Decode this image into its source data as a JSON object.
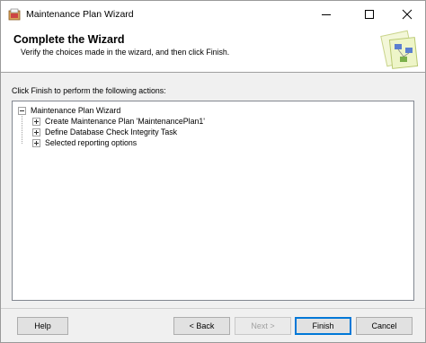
{
  "window": {
    "title": "Maintenance Plan Wizard"
  },
  "header": {
    "title": "Complete the Wizard",
    "subtitle": "Verify the choices made in the wizard, and then click Finish."
  },
  "instruction": "Click Finish to perform the following actions:",
  "tree": {
    "root": "Maintenance Plan Wizard",
    "items": [
      "Create Maintenance Plan 'MaintenancePlan1'",
      "Define Database Check Integrity Task",
      "Selected reporting options"
    ]
  },
  "buttons": {
    "help": "Help",
    "back": "< Back",
    "next": "Next >",
    "finish": "Finish",
    "cancel": "Cancel"
  },
  "icons": {
    "app": "wizard-app-icon",
    "minimize": "minimize-icon",
    "maximize": "maximize-icon",
    "close": "close-icon",
    "header_graphic": "wizard-graphic-icon",
    "expander": "tree-expander-icon"
  },
  "colors": {
    "accent": "#0078d7",
    "dialog_bg": "#f0f0f0"
  }
}
